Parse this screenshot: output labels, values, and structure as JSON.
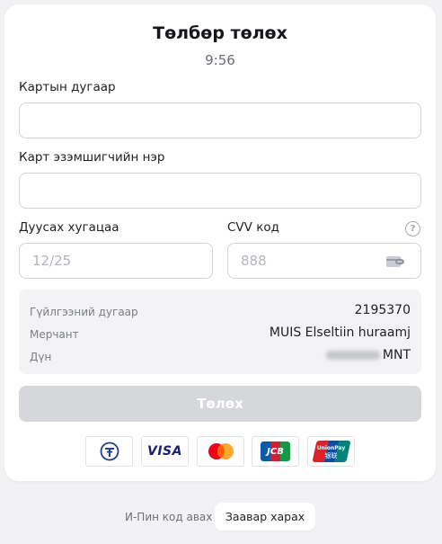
{
  "header": {
    "title": "Төлбөр төлөх",
    "timer": "9:56"
  },
  "form": {
    "card_number_label": "Картын дугаар",
    "card_number_value": "",
    "holder_label": "Карт эзэмшигчийн нэр",
    "holder_value": "",
    "expiry_label": "Дуусах хугацаа",
    "expiry_placeholder": "12/25",
    "cvv_label": "CVV код",
    "cvv_placeholder": "888",
    "help_glyph": "?"
  },
  "summary": {
    "rows": [
      {
        "key": "Гүйлгээний дугаар",
        "value": "2195370"
      },
      {
        "key": "Мерчант",
        "value": "MUIS Elseltiin huraamj"
      },
      {
        "key": "Дүн",
        "value": "MNT"
      }
    ]
  },
  "pay_button": {
    "label": "Төлөх",
    "state": "disabled"
  },
  "payment_logos": [
    "qpay-icon",
    "visa-icon",
    "mastercard-icon",
    "jcb-icon",
    "unionpay-icon"
  ],
  "logo_text": {
    "visa": "VISA",
    "jcb": "JCB",
    "unionpay": "UnionPay",
    "unionpay_cn": "银联"
  },
  "footer": {
    "pin_text": "И-Пин код авах",
    "guide_button": "Заавар харах"
  },
  "colors": {
    "background": "#f2f2f4",
    "card": "#ffffff",
    "button_disabled": "#d6d7db",
    "visa_blue": "#1a1f71",
    "mastercard_red": "#eb001b",
    "mastercard_orange": "#f79e1b"
  }
}
